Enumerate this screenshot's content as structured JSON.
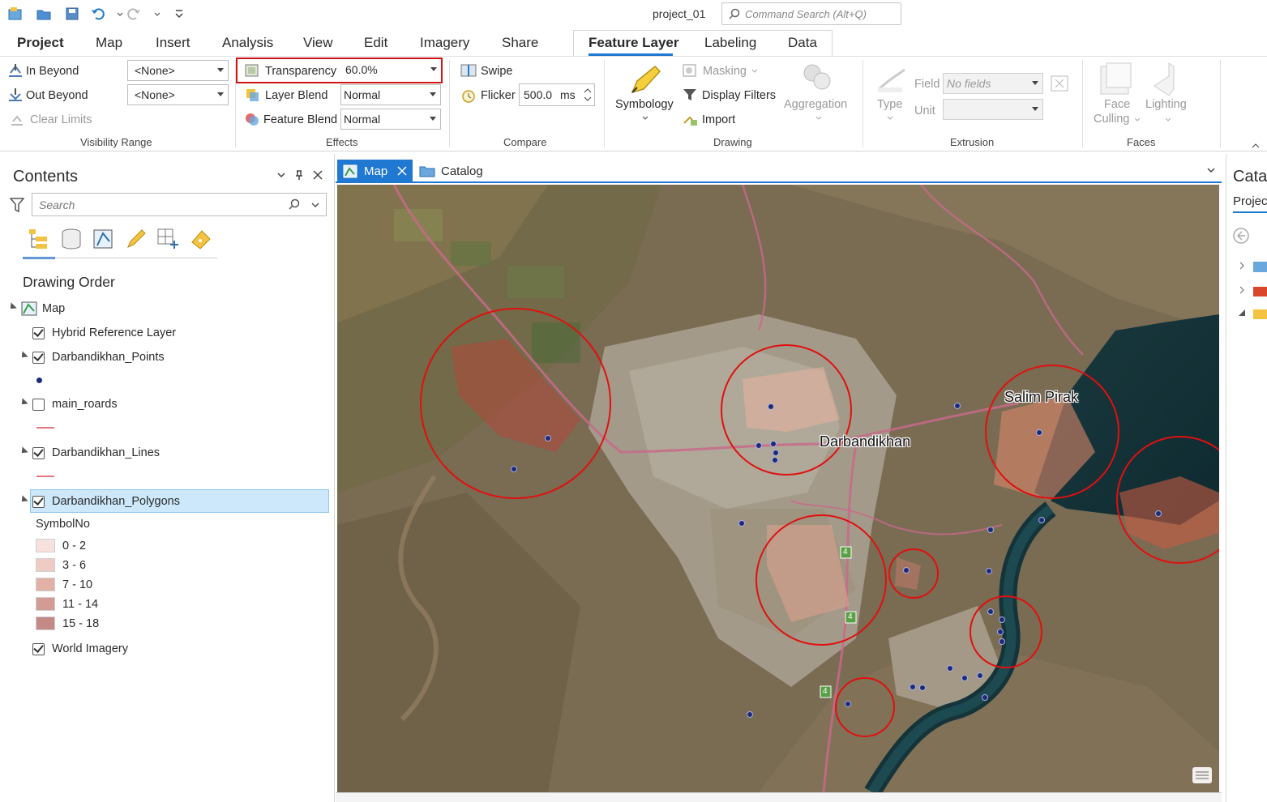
{
  "title_bar": {
    "project_name": "project_01",
    "command_search_placeholder": "Command Search (Alt+Q)"
  },
  "ribbon_tabs": [
    "Project",
    "Map",
    "Insert",
    "Analysis",
    "View",
    "Edit",
    "Imagery",
    "Share",
    "Feature Layer",
    "Labeling",
    "Data"
  ],
  "visibility_range": {
    "in_beyond": "In Beyond",
    "out_beyond": "Out Beyond",
    "clear_limits": "Clear Limits",
    "in_value": "<None>",
    "out_value": "<None>",
    "group": "Visibility Range"
  },
  "effects": {
    "transparency_label": "Transparency",
    "transparency_value": "60.0%",
    "layer_blend_label": "Layer Blend",
    "layer_blend_value": "Normal",
    "feature_blend_label": "Feature Blend",
    "feature_blend_value": "Normal",
    "group": "Effects"
  },
  "compare": {
    "swipe": "Swipe",
    "flicker": "Flicker",
    "flicker_value": "500.0",
    "flicker_unit": "ms",
    "group": "Compare"
  },
  "drawing": {
    "symbology": "Symbology",
    "masking": "Masking",
    "display_filters": "Display Filters",
    "import": "Import",
    "aggregation": "Aggregation",
    "group": "Drawing"
  },
  "extrusion": {
    "type": "Type",
    "field": "Field",
    "field_value": "No fields",
    "unit": "Unit",
    "group": "Extrusion"
  },
  "faces": {
    "face_culling_1": "Face",
    "face_culling_2": "Culling",
    "lighting": "Lighting",
    "group": "Faces"
  },
  "contents": {
    "title": "Contents",
    "search_placeholder": "Search",
    "drawing_order": "Drawing Order",
    "map": "Map",
    "layers": {
      "hybrid": "Hybrid Reference Layer",
      "points": "Darbandikhan_Points",
      "roads": "main_roards",
      "lines": "Darbandikhan_Lines",
      "polygons": "Darbandikhan_Polygons",
      "world_imagery": "World Imagery"
    },
    "legend_field": "SymbolNo",
    "legend_classes": [
      "0 - 2",
      "3 - 6",
      "7 - 10",
      "11 - 14",
      "15 - 18"
    ],
    "legend_colors": [
      "#f6e1dc",
      "#eecbc3",
      "#e2b0a6",
      "#d29b93",
      "#c48b86"
    ]
  },
  "view_tabs": {
    "map": "Map",
    "catalog": "Catalog"
  },
  "map_labels": {
    "darbandikhan": "Darbandikhan",
    "salim_pirak": "Salim Pirak"
  },
  "route_shields": [
    "4",
    "4",
    "4"
  ],
  "catalog_pane": {
    "title": "Catal",
    "project_tab": "Projec"
  },
  "colors": {
    "accent": "#1f78d1",
    "highlight_box": "#d11414",
    "selection": "#cde8fb",
    "road": "#c86a8a"
  }
}
